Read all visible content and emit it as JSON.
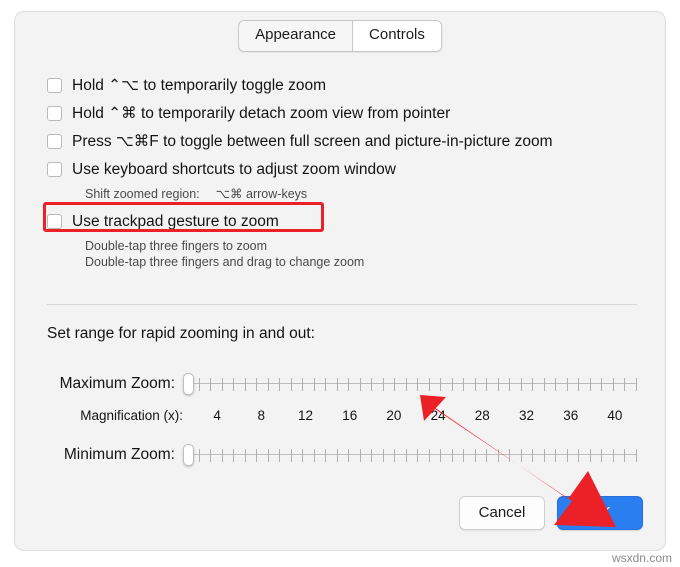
{
  "dialog": {
    "tabs": [
      {
        "label": "Appearance",
        "active": false
      },
      {
        "label": "Controls",
        "active": true
      }
    ],
    "options": [
      {
        "label": "Hold ⌃⌥ to temporarily toggle zoom",
        "checked": false
      },
      {
        "label": "Hold ⌃⌘ to temporarily detach zoom view from pointer",
        "checked": false
      },
      {
        "label": "Press ⌥⌘F to toggle between full screen and picture-in-picture zoom",
        "checked": false
      },
      {
        "label": "Use keyboard shortcuts to adjust zoom window",
        "checked": false
      },
      {
        "label": "Use trackpad gesture to zoom",
        "checked": false
      }
    ],
    "sub_keyboard": {
      "left": "Shift zoomed region:",
      "right": "⌥⌘ arrow-keys"
    },
    "sub_trackpad": [
      "Double-tap three fingers to zoom",
      "Double-tap three fingers and drag to change zoom"
    ],
    "section_title": "Set range for rapid zooming in and out:",
    "sliders": {
      "maximum": {
        "label": "Maximum Zoom:",
        "value_position_pct": 0
      },
      "minimum": {
        "label": "Minimum Zoom:",
        "value_position_pct": 0
      },
      "magnification_label": "Magnification (x):",
      "magnification_values": [
        "4",
        "8",
        "12",
        "16",
        "20",
        "24",
        "28",
        "32",
        "36",
        "40"
      ]
    },
    "buttons": {
      "cancel": "Cancel",
      "ok": "OK"
    },
    "highlight_color": "#ec2027",
    "accent_color": "#2b7ef0"
  },
  "watermark": "wsxdn.com"
}
